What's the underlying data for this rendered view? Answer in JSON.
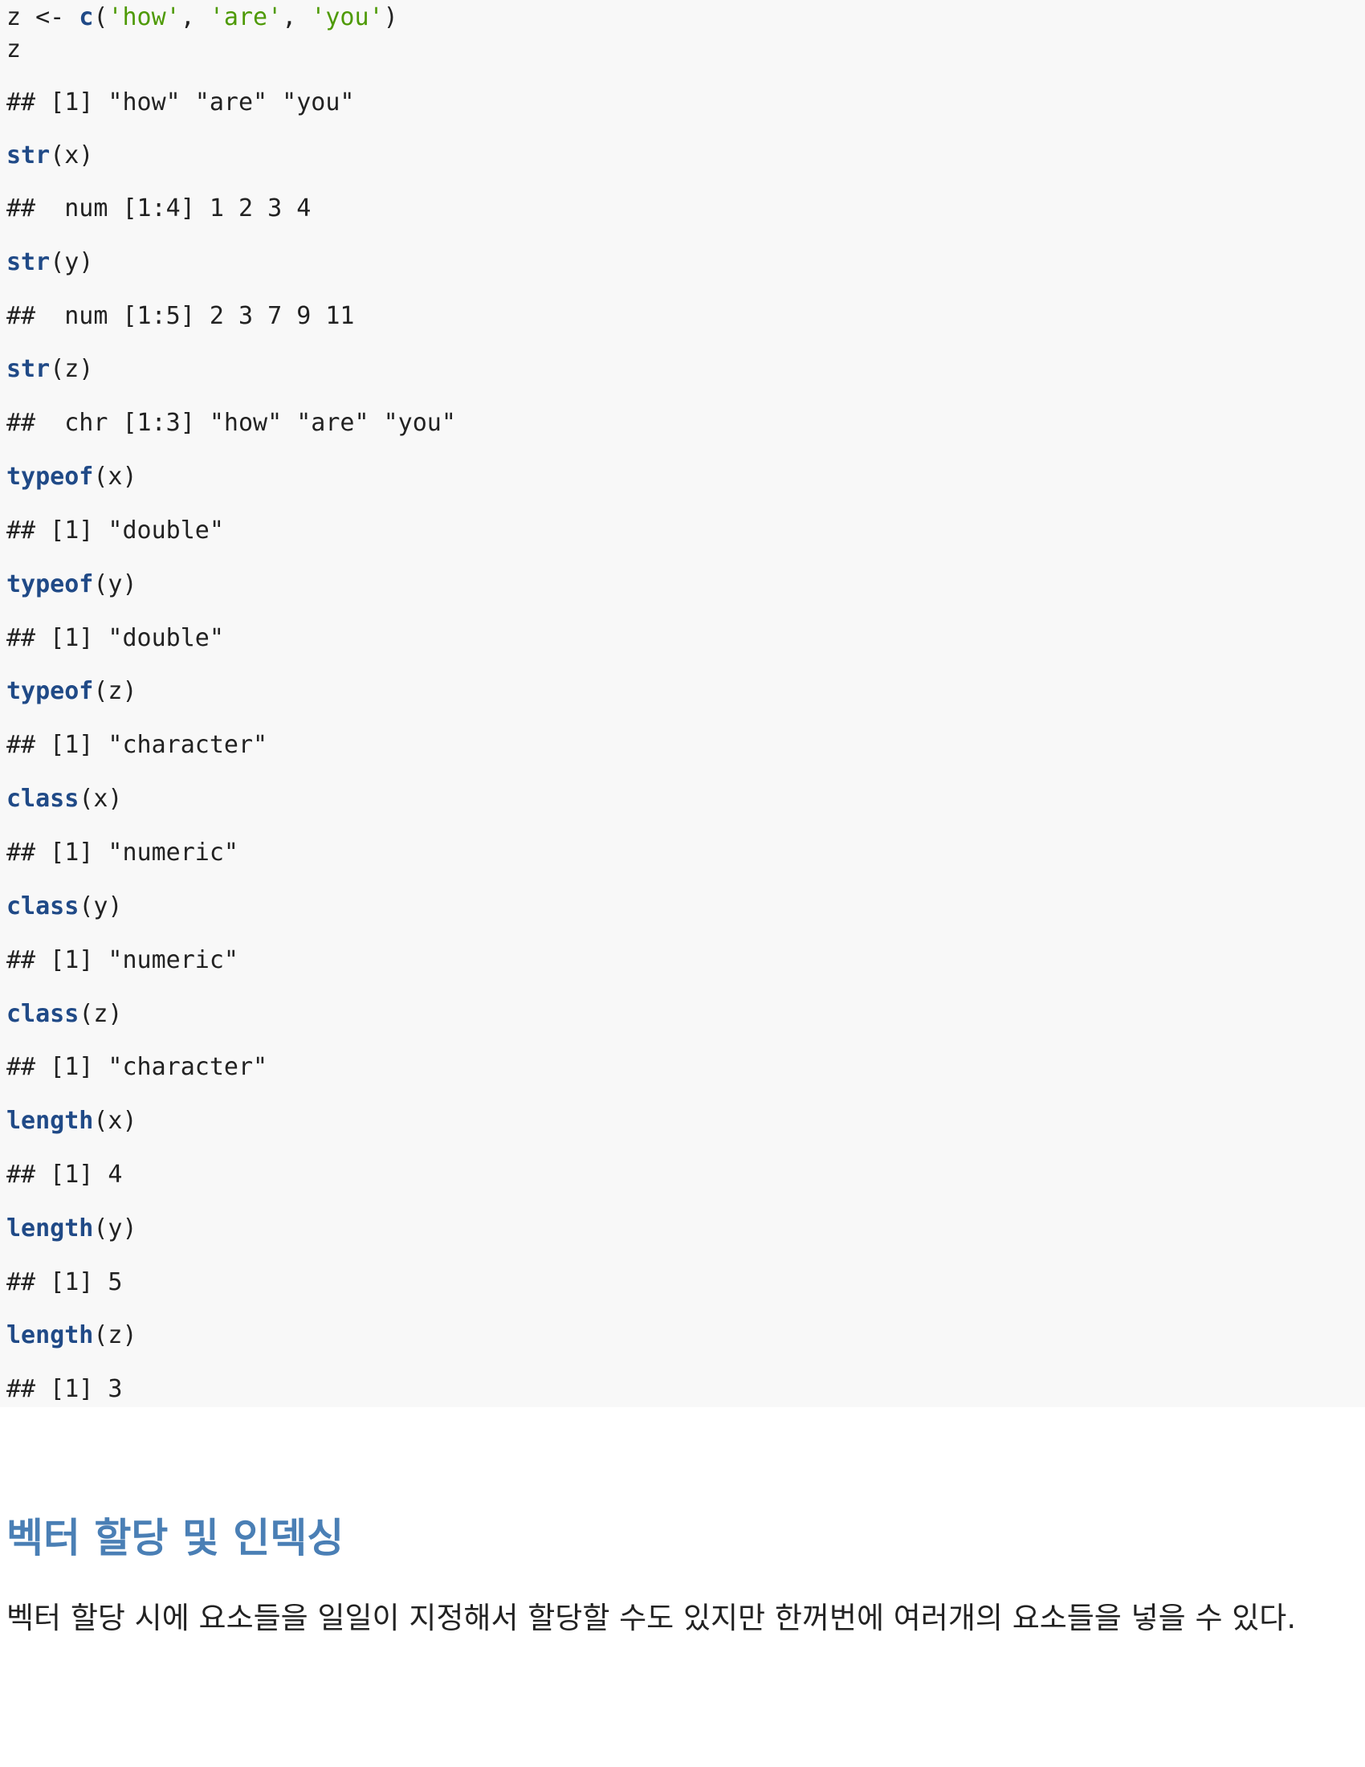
{
  "code": {
    "line_z_assign": {
      "var": "z <- ",
      "fn": "c",
      "open": "(",
      "s1": "'how'",
      "sep1": ", ",
      "s2": "'are'",
      "sep2": ", ",
      "s3": "'you'",
      "close": ")"
    },
    "line_z": "z",
    "out_z": "## [1] \"how\" \"are\" \"you\"",
    "calls": [
      {
        "fn": "str",
        "arg": "(x)",
        "out": "##  num [1:4] 1 2 3 4"
      },
      {
        "fn": "str",
        "arg": "(y)",
        "out": "##  num [1:5] 2 3 7 9 11"
      },
      {
        "fn": "str",
        "arg": "(z)",
        "out": "##  chr [1:3] \"how\" \"are\" \"you\""
      },
      {
        "fn": "typeof",
        "arg": "(x)",
        "out": "## [1] \"double\""
      },
      {
        "fn": "typeof",
        "arg": "(y)",
        "out": "## [1] \"double\""
      },
      {
        "fn": "typeof",
        "arg": "(z)",
        "out": "## [1] \"character\""
      },
      {
        "fn": "class",
        "arg": "(x)",
        "out": "## [1] \"numeric\""
      },
      {
        "fn": "class",
        "arg": "(y)",
        "out": "## [1] \"numeric\""
      },
      {
        "fn": "class",
        "arg": "(z)",
        "out": "## [1] \"character\""
      },
      {
        "fn": "length",
        "arg": "(x)",
        "out": "## [1] 4"
      },
      {
        "fn": "length",
        "arg": "(y)",
        "out": "## [1] 5"
      },
      {
        "fn": "length",
        "arg": "(z)",
        "out": "## [1] 3"
      }
    ]
  },
  "section": {
    "heading": "벡터 할당 및 인덱싱",
    "paragraph": "벡터 할당 시에 요소들을 일일이 지정해서 할당할 수도 있지만 한꺼번에 여러개의 요소들을 넣을 수 있다."
  },
  "colors": {
    "code_background": "#f8f8f8",
    "function": "#204a87",
    "string": "#4e9a06",
    "heading": "#4a7fb5"
  }
}
